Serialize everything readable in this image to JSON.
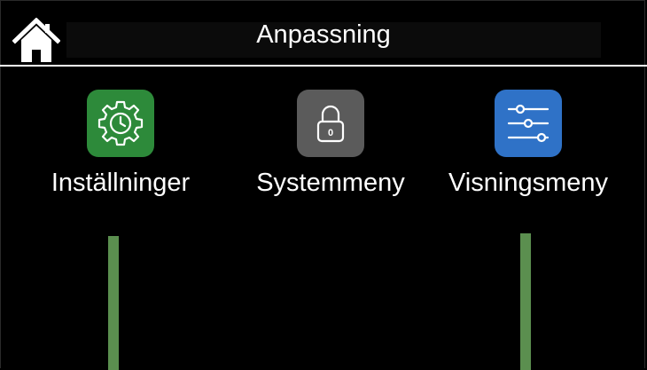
{
  "header": {
    "title": "Anpassning",
    "home_icon": "home-icon"
  },
  "menu": {
    "items": [
      {
        "label": "Inställninger",
        "icon": "gear-clock-icon",
        "color": "#2d8a3a"
      },
      {
        "label": "Systemmeny",
        "icon": "padlock-icon",
        "color": "#5b5b5b"
      },
      {
        "label": "Visningsmeny",
        "icon": "sliders-icon",
        "color": "#2f72c7"
      }
    ]
  },
  "colors": {
    "background": "#000000",
    "text": "#ffffff",
    "indicator_bar": "#5b8f4f"
  }
}
